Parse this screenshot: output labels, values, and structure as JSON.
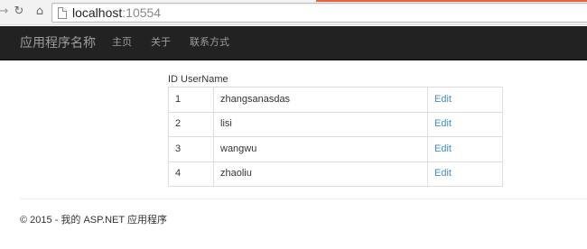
{
  "browser": {
    "url_host": "localhost",
    "url_port": ":10554",
    "icons": [
      "back-icon",
      "reload-icon",
      "home-icon",
      "page-icon"
    ]
  },
  "navbar": {
    "brand": "应用程序名称",
    "links": [
      "主页",
      "关于",
      "联系方式"
    ]
  },
  "table": {
    "heading": "ID UserName",
    "rows": [
      {
        "id": "1",
        "username": "zhangsanasdas",
        "action": "Edit"
      },
      {
        "id": "2",
        "username": "lisi",
        "action": "Edit"
      },
      {
        "id": "3",
        "username": "wangwu",
        "action": "Edit"
      },
      {
        "id": "4",
        "username": "zhaoliu",
        "action": "Edit"
      }
    ]
  },
  "footer": {
    "text": "© 2015 - 我的 ASP.NET 应用程序"
  },
  "colors": {
    "navbar_bg": "#222222",
    "nav_text": "#9d9d9d",
    "link": "#428bca",
    "border": "#dddddd"
  }
}
